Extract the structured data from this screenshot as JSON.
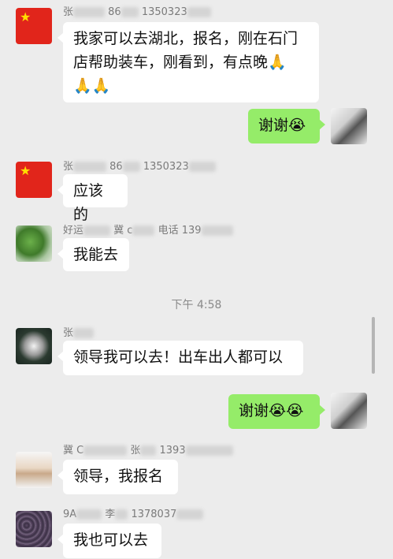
{
  "messages": [
    {
      "sender_visible": "张",
      "sender_tail": "86",
      "sender_tail2": "1350323",
      "text_line1": "我家可以去湖北，报名，刚在石门",
      "text_line2": "店帮助装车，刚看到，有点晚🙏",
      "text_line3": "🙏🙏"
    },
    {
      "self": true,
      "text": "谢谢😭"
    },
    {
      "sender_visible": "张",
      "sender_tail": "86",
      "sender_tail2": "1350323",
      "text": "应该的"
    },
    {
      "sender_visible": "好运",
      "sender_mid": "冀 c",
      "sender_tail": "电话 139",
      "text": "我能去"
    },
    {
      "sender_visible": "张",
      "text": "领导我可以去！出车出人都可以"
    },
    {
      "self": true,
      "text": "谢谢😭😭"
    },
    {
      "sender_visible": "冀 C",
      "sender_mid": "张",
      "sender_tail": "1393",
      "text": "领导，我报名"
    },
    {
      "sender_visible": "9A",
      "sender_mid": "李",
      "sender_tail": "1378037",
      "text": "我也可以去"
    }
  ],
  "timestamp": "下午 4:58",
  "icons": {
    "praying_hands": "🙏",
    "crying_face": "😭"
  },
  "colors": {
    "self_bubble": "#95ec69",
    "other_bubble": "#ffffff",
    "background": "#ececec"
  }
}
